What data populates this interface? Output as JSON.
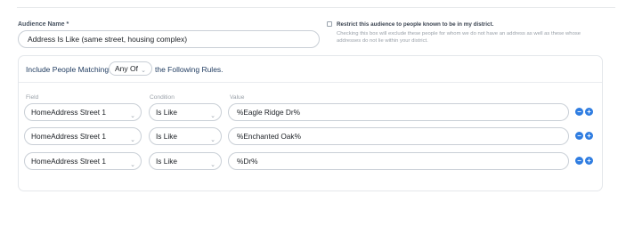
{
  "audience": {
    "name_label": "Audience Name *",
    "name_value": "Address Is Like (same street, housing complex)"
  },
  "restrict": {
    "checked": false,
    "label": "Restrict this audience to people known to be in my district.",
    "note": "Checking this box will exclude these people for whom we do not have an address as well as these whose addresses do not lie within your district."
  },
  "rules": {
    "header_prefix": "Include People Matching",
    "match_mode": "Any Of",
    "header_suffix": "the Following Rules.",
    "columns": {
      "field": "Field",
      "condition": "Condition",
      "value": "Value"
    },
    "rows": [
      {
        "field": "HomeAddress Street 1",
        "condition": "Is Like",
        "value": "%Eagle Ridge Dr%"
      },
      {
        "field": "HomeAddress Street 1",
        "condition": "Is Like",
        "value": "%Enchanted Oak%"
      },
      {
        "field": "HomeAddress Street 1",
        "condition": "Is Like",
        "value": "%Dr%"
      }
    ]
  },
  "icons": {
    "remove": "minus-circle-icon",
    "add": "plus-circle-icon",
    "dropdown": "chevron-down-icon"
  },
  "colors": {
    "accent": "#2f7de1",
    "heading": "#1e3a5f"
  }
}
